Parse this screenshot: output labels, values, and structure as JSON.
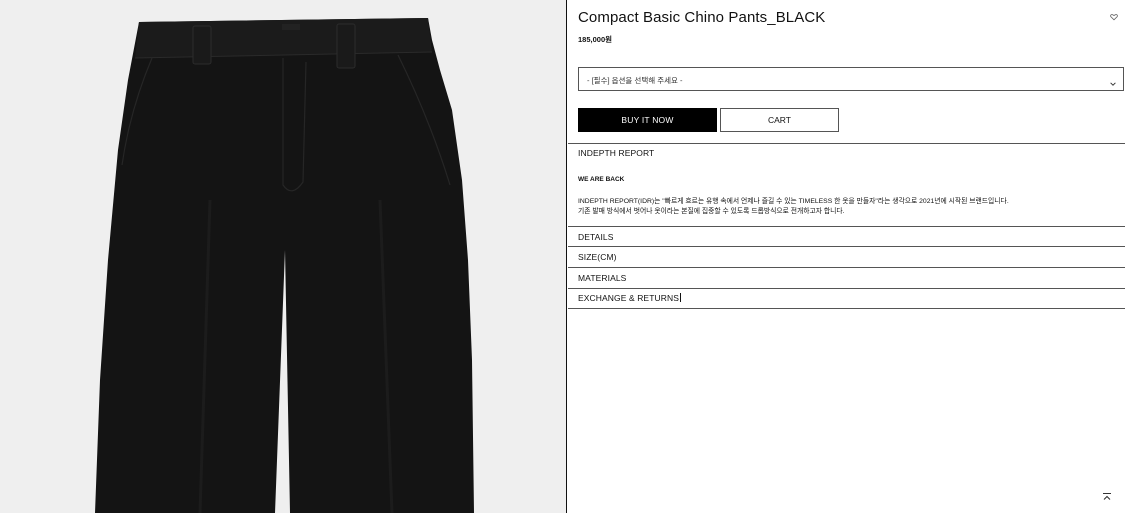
{
  "product": {
    "title": "Compact Basic Chino Pants_BLACK",
    "price": "185,000원",
    "image_alt": "Black chino pants product photo"
  },
  "option_select": {
    "selected": "- [필수] 옵션을 선택해 주세요 -"
  },
  "actions": {
    "buy_label": "BUY IT NOW",
    "cart_label": "CART"
  },
  "accordion": {
    "indepth": {
      "heading": "INDEPTH REPORT",
      "body_title": "WE ARE BACK",
      "body_line1": "INDEPTH REPORT(IDR)는 \"빠르게 흐르는 유행 속에서 언제나 즐길 수 있는 TIMELESS 한 옷을 만들자\"라는 생각으로 2021년에 시작된 브랜드입니다.",
      "body_line2": "기존 발매 방식에서 벗어나 옷이라는 본질에 집중할 수 있도록 드롭방식으로 전개하고자 합니다."
    },
    "details": "DETAILS",
    "size": "SIZE(CM)",
    "materials": "MATERIALS",
    "exchange": "EXCHANGE & RETURNS"
  },
  "icons": {
    "wish": "heart-icon",
    "select_chevron": "chevron-down-icon",
    "scroll_top": "scroll-to-top-icon"
  },
  "colors": {
    "primary_button": "#000000",
    "image_background": "#efefef",
    "garment": "#141414"
  }
}
